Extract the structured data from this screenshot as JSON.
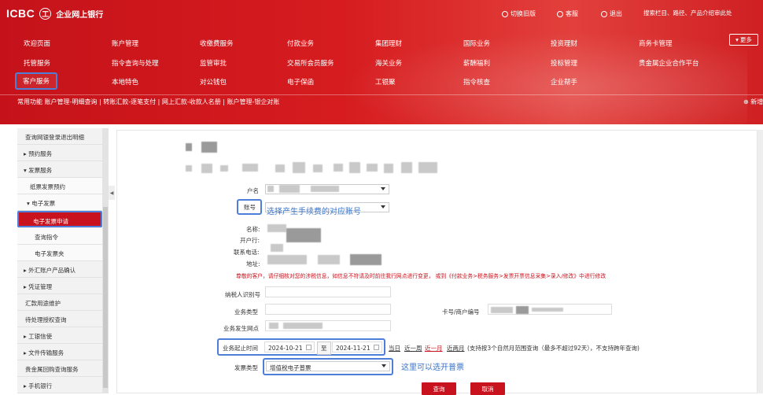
{
  "header": {
    "logo_text": "ICBC",
    "logo_seal": "工",
    "bank_name": "企业网上银行",
    "links": [
      {
        "icon": "switch-icon",
        "label": "切换旧版"
      },
      {
        "icon": "headset-icon",
        "label": "客服"
      },
      {
        "icon": "power-icon",
        "label": "退出"
      }
    ],
    "search_placeholder": "搜索栏目、路径、产品介绍审此处"
  },
  "menu": {
    "row1": [
      "欢迎页面",
      "账户管理",
      "收缴费服务",
      "付款业务",
      "集团理财",
      "国际业务",
      "投资理财",
      "商务卡管理"
    ],
    "row2": [
      "托管服务",
      "指令查询与处理",
      "监管审批",
      "交易所会员服务",
      "海关业务",
      "薪酬福利",
      "投标管理",
      "贵金属企业合作平台"
    ],
    "row3": [
      "客户服务",
      "本地特色",
      "对公钱包",
      "电子保函",
      "工银聚",
      "指令核查",
      "企业帮手"
    ],
    "more": "更多"
  },
  "common": {
    "text": "常用功能  账户管理-明细查询 | 转账汇款-逐笔支付 | 网上汇款-收款人名册 | 账户管理-银企对账",
    "add": "⊕ 新增"
  },
  "sidebar": {
    "items": [
      {
        "label": "查询网银登录退出明细",
        "indent": 0
      },
      {
        "label": "▸ 预约服务",
        "indent": 0
      },
      {
        "label": "▾ 发票服务",
        "indent": 0
      },
      {
        "label": "纸票发票预约",
        "indent": 1
      },
      {
        "label": "▾ 电子发票",
        "indent": 1
      },
      {
        "label": "电子发票申请",
        "indent": 2,
        "active": true
      },
      {
        "label": "查询指令",
        "indent": 2
      },
      {
        "label": "电子发票夹",
        "indent": 2
      },
      {
        "label": "▸ 外汇账户产品确认",
        "indent": 0
      },
      {
        "label": "▸ 凭证管理",
        "indent": 0
      },
      {
        "label": "汇款用途维护",
        "indent": 0
      },
      {
        "label": "待处理授权查询",
        "indent": 0
      },
      {
        "label": "▸ 工银信使",
        "indent": 0
      },
      {
        "label": "▸ 文件传输服务",
        "indent": 0
      },
      {
        "label": "贵金属回购查询服务",
        "indent": 0
      },
      {
        "label": "▸ 手机银行",
        "indent": 0
      }
    ]
  },
  "form": {
    "account_name_label": "户名",
    "account_no_label": "账号",
    "account_anno": "选择产生手续费的对应账号",
    "name_label": "名称:",
    "bank_label": "开户行:",
    "phone_label": "联系电话:",
    "address_label": "地址:",
    "notice": "尊敬的客户，请仔细核对您的涉税信息，如信息不符请及时前往我行网点进行变更， 或到《付款业务>税务服务>发票开票信息采集>录入/修改》中进行修改",
    "taxpayer_label": "纳税人识别号",
    "biz_type_label": "业务类型",
    "card_label": "卡号/商户编号",
    "branch_label": "业务发生网点",
    "period_label": "业务起止时间",
    "date_from": "2024-10-21",
    "date_sep": "至",
    "date_to": "2024-11-21",
    "quick": [
      "当日",
      "近一周",
      "近一月",
      "近两月"
    ],
    "period_hint": "(支持按3个自然月范围查询（最多不超过92天），不支持跨年查询)",
    "invoice_type_label": "发票类型",
    "invoice_type_value": "增值税电子普票",
    "invoice_anno": "这里可以选开普票",
    "query_btn": "查询",
    "cancel_btn": "取消"
  },
  "colors": {
    "brand_red": "#c8121d",
    "highlight_blue": "#4d7ed8",
    "anno_blue": "#3a73c8"
  }
}
